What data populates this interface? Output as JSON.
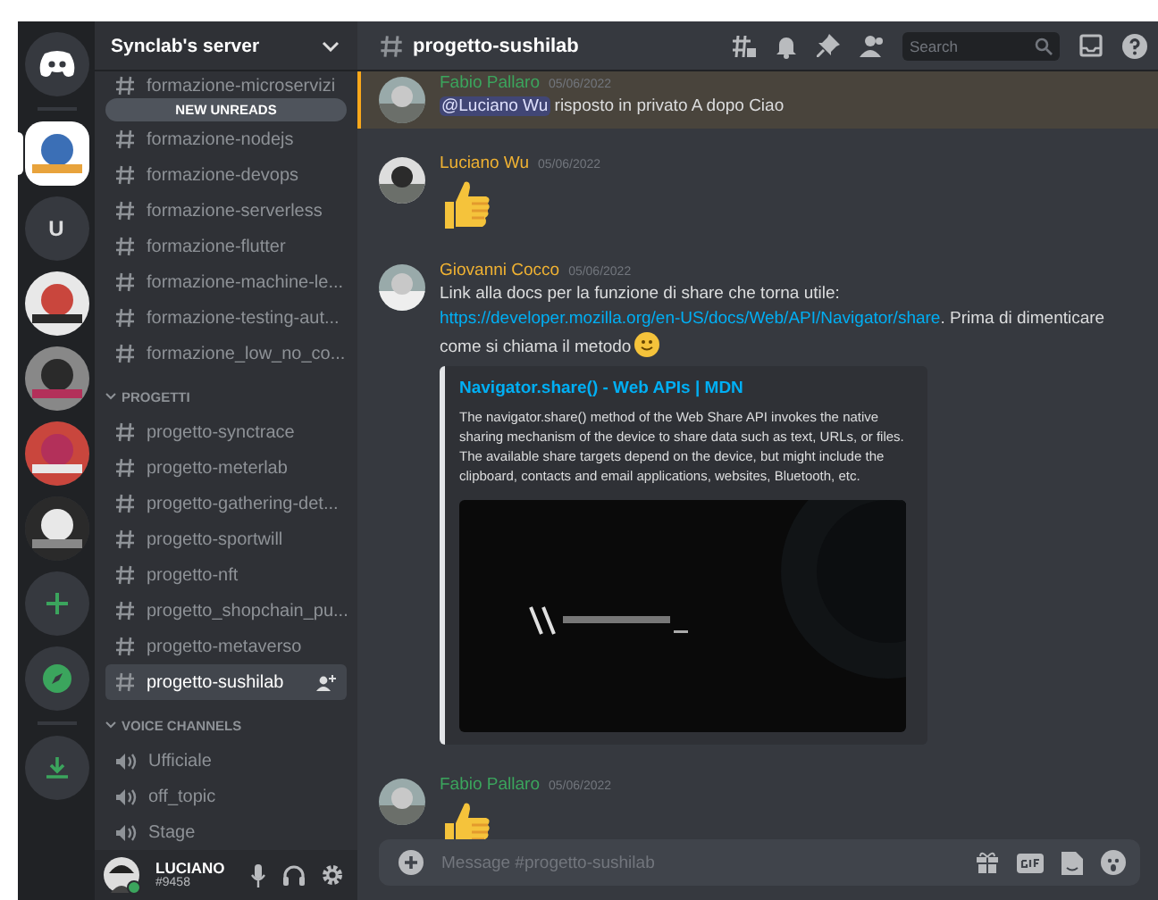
{
  "servers": [
    {
      "kind": "home",
      "selected": false
    },
    {
      "kind": "picture",
      "selected": true
    },
    {
      "kind": "letter",
      "label": "U",
      "selected": false
    },
    {
      "kind": "picture",
      "selected": false
    },
    {
      "kind": "picture",
      "selected": false
    },
    {
      "kind": "picture",
      "selected": false
    },
    {
      "kind": "picture",
      "selected": false
    },
    {
      "kind": "add",
      "selected": false
    },
    {
      "kind": "explore",
      "selected": false
    },
    {
      "kind": "download",
      "selected": false
    }
  ],
  "server_name": "Synclab's server",
  "unread_banner": "NEW UNREADS",
  "categories": [
    {
      "voice": false,
      "channels": [
        {
          "name": "formazione-microservizi",
          "selected": false
        },
        {
          "name": "formazione-nodejs",
          "selected": false
        },
        {
          "name": "formazione-devops",
          "selected": false
        },
        {
          "name": "formazione-serverless",
          "selected": false
        },
        {
          "name": "formazione-flutter",
          "selected": false
        },
        {
          "name": "formazione-machine-le...",
          "selected": false
        },
        {
          "name": "formazione-testing-aut...",
          "selected": false
        },
        {
          "name": "formazione_low_no_co...",
          "selected": false
        }
      ]
    },
    {
      "name": "PROGETTI",
      "voice": false,
      "channels": [
        {
          "name": "progetto-synctrace",
          "selected": false
        },
        {
          "name": "progetto-meterlab",
          "selected": false
        },
        {
          "name": "progetto-gathering-det...",
          "selected": false
        },
        {
          "name": "progetto-sportwill",
          "selected": false
        },
        {
          "name": "progetto-nft",
          "selected": false
        },
        {
          "name": "progetto_shopchain_pu...",
          "selected": false
        },
        {
          "name": "progetto-metaverso",
          "selected": false
        },
        {
          "name": "progetto-sushilab",
          "selected": true
        }
      ]
    },
    {
      "name": "VOICE CHANNELS",
      "voice": true,
      "channels": [
        {
          "name": "Ufficiale",
          "selected": false
        },
        {
          "name": "off_topic",
          "selected": false
        },
        {
          "name": "Stage",
          "selected": false
        }
      ]
    }
  ],
  "user": {
    "name": "LUCIANO",
    "tag": "#9458"
  },
  "channel_title": "progetto-sushilab",
  "search": {
    "placeholder": "Search"
  },
  "messages": [
    {
      "author": "Fabio Pallaro",
      "color": "#3ba55d",
      "date": "05/06/2022",
      "highlight": true,
      "mention": "@Luciano Wu",
      "text": " risposto in privato A dopo Ciao"
    },
    {
      "author": "Luciano Wu",
      "color": "#f0b232",
      "date": "05/06/2022",
      "highlight": false,
      "thumbs": true
    },
    {
      "author": "Giovanni Cocco",
      "color": "#f0b232",
      "date": "05/06/2022",
      "highlight": false,
      "text": "Link alla docs per la funzione di share che torna utile: ",
      "link": "https://developer.mozilla.org/en-US/docs/Web/API/Navigator/share",
      "after": ". Prima di dimenticare come si chiama il metodo",
      "smile": true,
      "embed": {
        "title": "Navigator.share() - Web APIs | MDN",
        "description": "The navigator.share() method of the Web Share API invokes the native sharing mechanism of the device to share data such as text, URLs, or files. The available share targets depend on the device, but might include the clipboard, contacts and email applications, websites, Bluetooth, etc."
      }
    },
    {
      "author": "Fabio Pallaro",
      "color": "#3ba55d",
      "date": "05/06/2022",
      "highlight": false,
      "thumbs": true
    }
  ],
  "composer": {
    "placeholder": "Message #progetto-sushilab"
  }
}
